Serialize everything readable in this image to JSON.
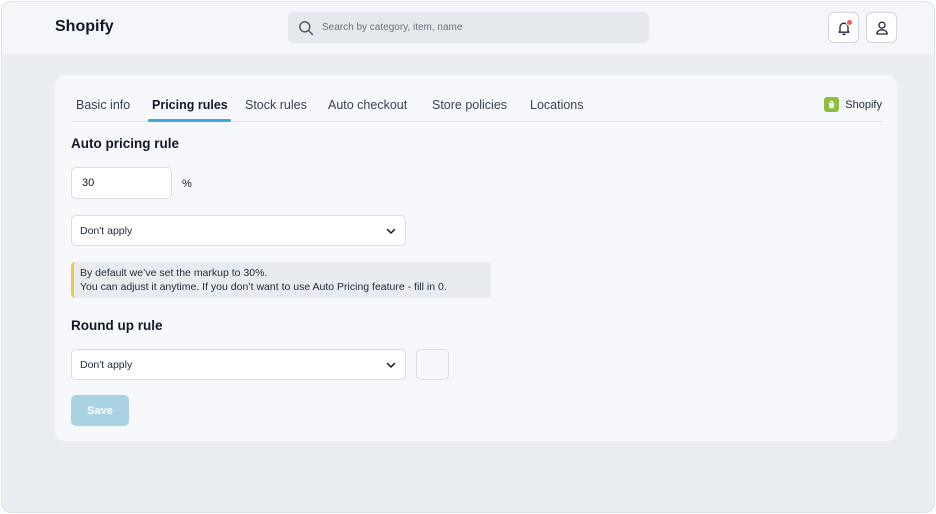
{
  "header": {
    "brand": "Shopify",
    "search_placeholder": "Search by category, item, name"
  },
  "tabs": [
    {
      "label": "Basic info"
    },
    {
      "label": "Pricing rules"
    },
    {
      "label": "Stock rules"
    },
    {
      "label": "Auto checkout"
    },
    {
      "label": "Store policies"
    },
    {
      "label": "Locations"
    }
  ],
  "platform_badge": "Shopify",
  "auto_pricing": {
    "title": "Auto pricing rule",
    "markup_value": "30",
    "unit": "%",
    "select_value": "Don't apply",
    "note_line1": "By default we’ve set the markup to 30%.",
    "note_line2": "You can adjust it anytime. If you don’t want to use Auto Pricing feature - fill in 0."
  },
  "round_up": {
    "title": "Round up rule",
    "select_value": "Don't apply"
  },
  "save_label": "Save",
  "colors": {
    "accent": "#3aa8dc",
    "note_border": "#f3c64b",
    "save_disabled": "#a9d3e3",
    "shopify_green": "#8bbf3f"
  }
}
